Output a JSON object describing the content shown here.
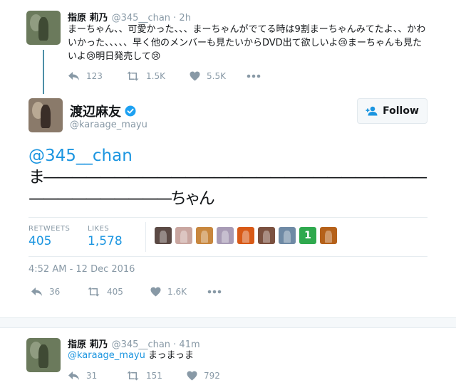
{
  "tweets": [
    {
      "name": "指原 莉乃",
      "handle": "@345__chan · 2h",
      "lines": [
        "まーちゃん、、可愛かった、、、まーちゃんがでてる時は9割まーちゃんみてたよ、、かわ",
        "いかった、、、、、早く他のメンバーも見たいからDVD出て欲しいよ😢まーちゃんも見た",
        "いよ😢明日発売して😢"
      ],
      "replies": "123",
      "retweets": "1.5K",
      "likes": "5.5K"
    },
    {
      "name": "指原 莉乃",
      "handle": "@345__chan · 41m",
      "mention": "@karaage_mayu",
      "text": " まっまっま",
      "replies": "31",
      "retweets": "151",
      "likes": "792"
    }
  ],
  "main": {
    "name": "渡辺麻友",
    "handle": "@karaage_mayu",
    "follow_label": "Follow",
    "mention": "@345__chan",
    "line2": "ま———————————————————————————",
    "line3": "——————————ちゃん",
    "retweets_label": "RETWEETS",
    "retweets_value": "405",
    "likes_label": "LIKES",
    "likes_value": "1,578",
    "timestamp": "4:52 AM - 12 Dec 2016",
    "replies": "36",
    "retweets": "405",
    "likes": "1.6K",
    "verified_color": "#1da1f2",
    "liker_colors": [
      "#5b4a45",
      "#c9a6a0",
      "#c8873e",
      "#a89bb5",
      "#d85a17",
      "#7b5140",
      "#6f8aa5",
      "#2fa94e",
      "#b5611a"
    ],
    "liker_badge": "1"
  },
  "colors": {
    "link": "#1b95e0",
    "icon": "#8899a6",
    "thread_line": "#4d8fa7"
  }
}
